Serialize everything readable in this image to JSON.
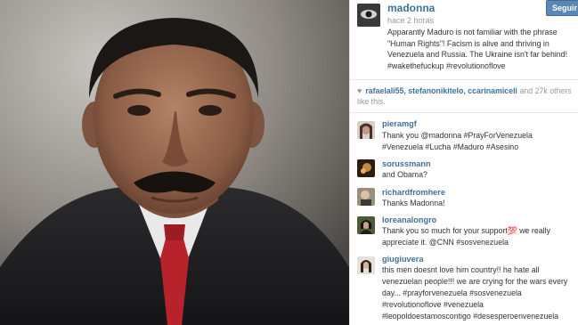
{
  "post": {
    "username": "madonna",
    "time": "hace 2 horas",
    "follow_label": "Seguir",
    "caption": "Apparantly Maduro is not familiar with the phrase \"Human Rights\"! Facism is alive and thriving in Venezuela and Russia. The Ukraine isn't far behind! #wakethefuckup #revolutionoflove"
  },
  "likes": {
    "names": "rafaelali55, stefanonikitelo, ccarinamiceli",
    "rest": " and 27k others like this."
  },
  "comments": [
    {
      "user": "pieramgf",
      "text": "Thank you @madonna #PrayForVenezuela #Venezuela #Lucha #Maduro #Asesino"
    },
    {
      "user": "sorussmann",
      "text": "and Obama?"
    },
    {
      "user": "richardfromhere",
      "text": "Thanks Madonna!"
    },
    {
      "user": "loreanalongro",
      "text": "Thank you so much for your support💯 we really appreciate it. @CNN #sosvenezuela"
    },
    {
      "user": "giugiuvera",
      "text": "this men doesnt love him country!! he hate all venezuelan people!!! we are crying for the wars every day... #prayforvenezuela #sosvenezuela #revolutionoflove #venezuela #leopoldoestamoscontigo #desesperoenvenezuela"
    }
  ],
  "colors": {
    "username": "#3f729b",
    "follow_button": "#5a87b3"
  }
}
